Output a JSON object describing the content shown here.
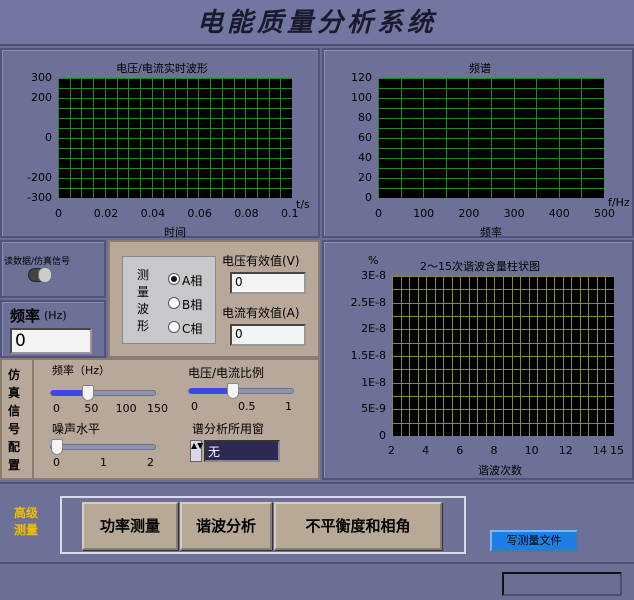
{
  "app": {
    "title": "电能质量分析系统"
  },
  "waveform_chart": {
    "title": "电压/电流实时波形",
    "x_unit": "t/s",
    "xlabel": "时间",
    "x_ticks": [
      "0",
      "0.02",
      "0.04",
      "0.06",
      "0.08",
      "0.1"
    ],
    "y_ticks": [
      "300",
      "200",
      "0",
      "-200",
      "-300"
    ]
  },
  "spectrum_chart": {
    "title": "频谱",
    "x_unit": "f/Hz",
    "xlabel": "频率",
    "x_ticks": [
      "0",
      "100",
      "200",
      "300",
      "400",
      "500"
    ],
    "y_ticks": [
      "120",
      "100",
      "80",
      "60",
      "40",
      "20",
      "0"
    ]
  },
  "harmonic_chart": {
    "title": "2～15次谐波含量柱状图",
    "y_unit": "%",
    "xlabel": "谐波次数",
    "x_ticks": [
      "2",
      "4",
      "6",
      "8",
      "10",
      "12",
      "14",
      "15"
    ],
    "y_ticks": [
      "3E-8",
      "2.5E-8",
      "2E-8",
      "1.5E-8",
      "1E-8",
      "5E-9",
      "0"
    ]
  },
  "source_switch": {
    "label": "读数据/仿真信号"
  },
  "frequency": {
    "label": "频率",
    "unit": "(Hz)",
    "value": "0"
  },
  "measure_phase": {
    "label_chars": [
      "测",
      "量",
      "波",
      "形"
    ],
    "options": [
      "A相",
      "B相",
      "C相"
    ],
    "selected": "A相"
  },
  "rms": {
    "voltage_label": "电压有效值(V)",
    "voltage_value": "0",
    "current_label": "电流有效值(A)",
    "current_value": "0"
  },
  "sim_config": {
    "label_chars": [
      "仿",
      "真",
      "信",
      "号",
      "配",
      "置"
    ],
    "freq_slider": {
      "label": "频率（Hz）",
      "ticks": [
        "0",
        "50",
        "100",
        "150"
      ],
      "value": 50,
      "min": 0,
      "max": 150
    },
    "ratio_slider": {
      "label": "电压/电流比例",
      "ticks": [
        "0",
        "0.5",
        "1"
      ],
      "value": 0.4,
      "min": 0,
      "max": 1
    },
    "noise_slider": {
      "label": "噪声水平",
      "ticks": [
        "0",
        "1",
        "2"
      ],
      "value": 0,
      "min": 0,
      "max": 2
    },
    "window": {
      "label": "谱分析所用窗",
      "value": "无"
    }
  },
  "advanced": {
    "label_line1": "高级",
    "label_line2": "测量",
    "buttons": [
      "功率测量",
      "谐波分析",
      "不平衡度和相角"
    ]
  },
  "write_file_button": "写测量文件",
  "colors": {
    "background": "#6b6f94",
    "plot_bg": "#000000",
    "grid_green": "#1f8a1f",
    "grid_yellow": "#8a8a3a",
    "slider_blue": "#3a48e8",
    "tan": "#b8a89a"
  }
}
